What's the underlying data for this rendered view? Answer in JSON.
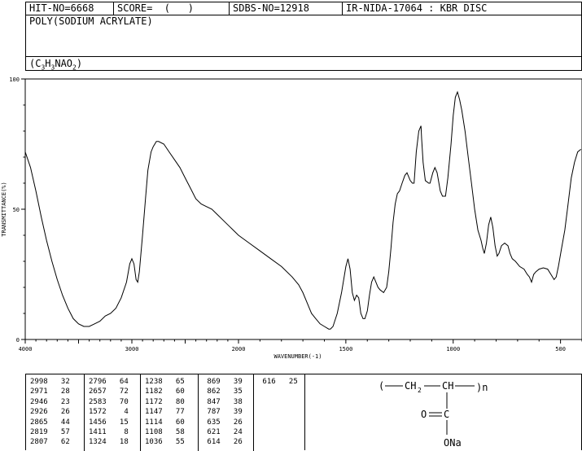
{
  "header": {
    "hit_no": "HIT-NO=6668",
    "score": "SCORE=  (   )",
    "sdbs_no": "SDBS-NO=12918",
    "ir_nida": "IR-NIDA-17064 : KBR DISC",
    "compound_name": "POLY(SODIUM ACRYLATE)",
    "formula": "(C3H3NAO2)"
  },
  "chart_data": {
    "type": "line",
    "title": "",
    "xlabel": "WAVENUMBER(-1)",
    "ylabel": "TRANSMITTANCE(%)",
    "xlim": [
      4000,
      400
    ],
    "ylim": [
      0,
      100
    ],
    "x_ticks": [
      "4000",
      "3000",
      "2000",
      "1500",
      "1000",
      "500"
    ],
    "y_ticks": [
      "100",
      "50",
      "0"
    ],
    "series": [
      {
        "name": "",
        "points": [
          [
            4000,
            72
          ],
          [
            3950,
            66
          ],
          [
            3900,
            57
          ],
          [
            3850,
            47
          ],
          [
            3800,
            38
          ],
          [
            3750,
            30
          ],
          [
            3700,
            23
          ],
          [
            3650,
            17
          ],
          [
            3600,
            12
          ],
          [
            3550,
            8
          ],
          [
            3500,
            6
          ],
          [
            3450,
            5
          ],
          [
            3400,
            5
          ],
          [
            3350,
            6
          ],
          [
            3300,
            7
          ],
          [
            3250,
            9
          ],
          [
            3200,
            10
          ],
          [
            3150,
            12
          ],
          [
            3100,
            16
          ],
          [
            3050,
            22
          ],
          [
            3020,
            29
          ],
          [
            3000,
            31
          ],
          [
            2980,
            29
          ],
          [
            2960,
            23
          ],
          [
            2945,
            22
          ],
          [
            2930,
            26
          ],
          [
            2900,
            40
          ],
          [
            2870,
            55
          ],
          [
            2850,
            65
          ],
          [
            2820,
            72
          ],
          [
            2800,
            74
          ],
          [
            2770,
            76
          ],
          [
            2750,
            76
          ],
          [
            2700,
            75
          ],
          [
            2650,
            72
          ],
          [
            2600,
            69
          ],
          [
            2550,
            66
          ],
          [
            2500,
            62
          ],
          [
            2450,
            58
          ],
          [
            2400,
            54
          ],
          [
            2350,
            52
          ],
          [
            2300,
            51
          ],
          [
            2250,
            50
          ],
          [
            2200,
            48
          ],
          [
            2150,
            46
          ],
          [
            2100,
            44
          ],
          [
            2050,
            42
          ],
          [
            2000,
            40
          ],
          [
            1950,
            37
          ],
          [
            1900,
            34
          ],
          [
            1850,
            31
          ],
          [
            1800,
            28
          ],
          [
            1750,
            24
          ],
          [
            1720,
            21
          ],
          [
            1700,
            18
          ],
          [
            1680,
            14
          ],
          [
            1660,
            10
          ],
          [
            1640,
            8
          ],
          [
            1620,
            6
          ],
          [
            1600,
            5
          ],
          [
            1580,
            4
          ],
          [
            1572,
            4
          ],
          [
            1560,
            5
          ],
          [
            1540,
            10
          ],
          [
            1520,
            18
          ],
          [
            1500,
            28
          ],
          [
            1490,
            31
          ],
          [
            1480,
            27
          ],
          [
            1470,
            18
          ],
          [
            1460,
            15
          ],
          [
            1450,
            17
          ],
          [
            1440,
            16
          ],
          [
            1430,
            10
          ],
          [
            1420,
            8
          ],
          [
            1411,
            8
          ],
          [
            1400,
            11
          ],
          [
            1390,
            17
          ],
          [
            1380,
            22
          ],
          [
            1370,
            24
          ],
          [
            1360,
            22
          ],
          [
            1350,
            20
          ],
          [
            1340,
            19
          ],
          [
            1324,
            18
          ],
          [
            1310,
            20
          ],
          [
            1300,
            26
          ],
          [
            1290,
            35
          ],
          [
            1280,
            45
          ],
          [
            1270,
            52
          ],
          [
            1260,
            56
          ],
          [
            1250,
            57
          ],
          [
            1238,
            60
          ],
          [
            1225,
            63
          ],
          [
            1215,
            64
          ],
          [
            1200,
            61
          ],
          [
            1190,
            60
          ],
          [
            1182,
            60
          ],
          [
            1172,
            72
          ],
          [
            1160,
            80
          ],
          [
            1150,
            82
          ],
          [
            1147,
            77
          ],
          [
            1140,
            68
          ],
          [
            1130,
            61
          ],
          [
            1114,
            60
          ],
          [
            1108,
            60
          ],
          [
            1095,
            64
          ],
          [
            1085,
            66
          ],
          [
            1075,
            64
          ],
          [
            1060,
            57
          ],
          [
            1050,
            55
          ],
          [
            1036,
            55
          ],
          [
            1025,
            62
          ],
          [
            1010,
            75
          ],
          [
            1000,
            86
          ],
          [
            990,
            93
          ],
          [
            980,
            95
          ],
          [
            970,
            92
          ],
          [
            960,
            88
          ],
          [
            945,
            80
          ],
          [
            930,
            70
          ],
          [
            915,
            60
          ],
          [
            900,
            50
          ],
          [
            885,
            42
          ],
          [
            870,
            38
          ],
          [
            862,
            35
          ],
          [
            855,
            33
          ],
          [
            845,
            37
          ],
          [
            835,
            44
          ],
          [
            825,
            47
          ],
          [
            815,
            43
          ],
          [
            805,
            36
          ],
          [
            795,
            32
          ],
          [
            787,
            33
          ],
          [
            775,
            36
          ],
          [
            760,
            37
          ],
          [
            745,
            36
          ],
          [
            735,
            33
          ],
          [
            725,
            31
          ],
          [
            710,
            30
          ],
          [
            690,
            28
          ],
          [
            670,
            27
          ],
          [
            655,
            25
          ],
          [
            645,
            24
          ],
          [
            635,
            22
          ],
          [
            625,
            25
          ],
          [
            615,
            26
          ],
          [
            600,
            27
          ],
          [
            580,
            27.5
          ],
          [
            560,
            27
          ],
          [
            545,
            25
          ],
          [
            530,
            23
          ],
          [
            520,
            24
          ],
          [
            510,
            28
          ],
          [
            495,
            35
          ],
          [
            480,
            42
          ],
          [
            465,
            52
          ],
          [
            450,
            62
          ],
          [
            435,
            68
          ],
          [
            420,
            72
          ],
          [
            405,
            73
          ]
        ]
      }
    ],
    "peak_table": [
      [
        [
          "2998",
          "32"
        ],
        [
          "2971",
          "28"
        ],
        [
          "2946",
          "23"
        ],
        [
          "2926",
          "26"
        ],
        [
          "2865",
          "44"
        ],
        [
          "2819",
          "57"
        ],
        [
          "2807",
          "62"
        ]
      ],
      [
        [
          "2796",
          "64"
        ],
        [
          "2657",
          "72"
        ],
        [
          "2583",
          "70"
        ],
        [
          "1572",
          "4"
        ],
        [
          "1456",
          "15"
        ],
        [
          "1411",
          "8"
        ],
        [
          "1324",
          "18"
        ]
      ],
      [
        [
          "1238",
          "65"
        ],
        [
          "1182",
          "60"
        ],
        [
          "1172",
          "80"
        ],
        [
          "1147",
          "77"
        ],
        [
          "1114",
          "60"
        ],
        [
          "1108",
          "58"
        ],
        [
          "1036",
          "55"
        ]
      ],
      [
        [
          "869",
          "39"
        ],
        [
          "862",
          "35"
        ],
        [
          "847",
          "38"
        ],
        [
          "787",
          "39"
        ],
        [
          "635",
          "26"
        ],
        [
          "621",
          "24"
        ],
        [
          "614",
          "26"
        ]
      ],
      [
        [
          "616",
          "25"
        ]
      ]
    ]
  },
  "structure": {
    "repeat_open": "(",
    "ch2": "CH",
    "ch2_sub": "2",
    "ch": "CH",
    "repeat_close": ")n",
    "oxygen": "O",
    "carbon": "C",
    "ona": "ONa"
  }
}
